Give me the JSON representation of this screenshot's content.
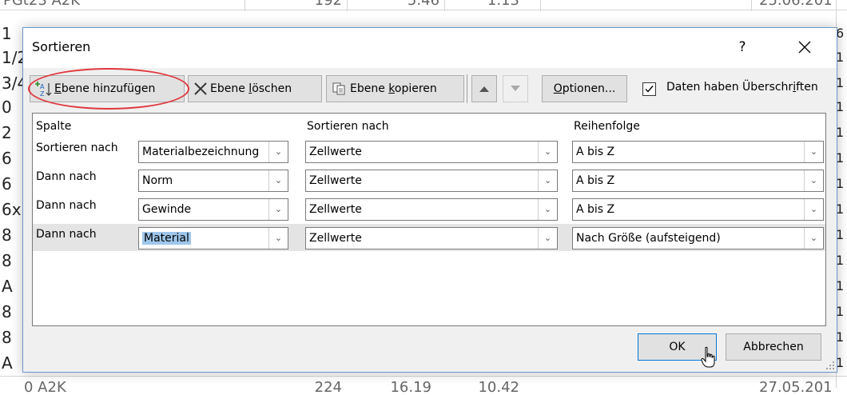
{
  "spreadsheet": {
    "top_row": [
      "PGt23 A2K",
      "192",
      "5.46",
      "1.13",
      "25.06.201"
    ],
    "left_column": [
      "1",
      "1/2",
      "3/4",
      "0",
      "2",
      "6",
      "6",
      "6x",
      "8",
      "8",
      "A",
      "8",
      "8",
      "A"
    ],
    "right_column": [
      "6",
      "1",
      "1",
      "1",
      "1",
      "1",
      "1",
      "1",
      "1",
      "1",
      "1",
      "1",
      "1",
      "1"
    ],
    "bottom_row": [
      "0 A2K",
      "224",
      "16.19",
      "10.42",
      "27.05.201"
    ]
  },
  "dialog": {
    "title": "Sortieren",
    "help_label": "?",
    "toolbar": {
      "add_level": {
        "pre": "",
        "u": "E",
        "post": "bene hinzufügen"
      },
      "delete_level": {
        "pre": "Ebene ",
        "u": "l",
        "post": "öschen"
      },
      "copy_level": {
        "pre": "Ebene ",
        "u": "k",
        "post": "opieren"
      },
      "options": {
        "pre": "",
        "u": "O",
        "post": "ptionen..."
      },
      "headers_checkbox": {
        "pre": "Daten haben Überschr",
        "u": "i",
        "post": "ften",
        "checked": true
      }
    },
    "columns": {
      "col1": "Spalte",
      "col2": "Sortieren nach",
      "col3": "Reihenfolge"
    },
    "rows": [
      {
        "label": "Sortieren nach",
        "column": "Materialbezeichnung",
        "sort_on": "Zellwerte",
        "order": "A bis Z"
      },
      {
        "label": "Dann nach",
        "column": "Norm",
        "sort_on": "Zellwerte",
        "order": "A bis Z"
      },
      {
        "label": "Dann nach",
        "column": "Gewinde",
        "sort_on": "Zellwerte",
        "order": "A bis Z"
      },
      {
        "label": "Dann nach",
        "column": "Material",
        "sort_on": "Zellwerte",
        "order": "Nach Größe (aufsteigend)"
      }
    ],
    "ok_label": "OK",
    "cancel_label": "Abbrechen"
  },
  "colors": {
    "highlight": "#e0393e",
    "selection": "#9ec6ea",
    "dialog_border": "#6d96c9"
  }
}
